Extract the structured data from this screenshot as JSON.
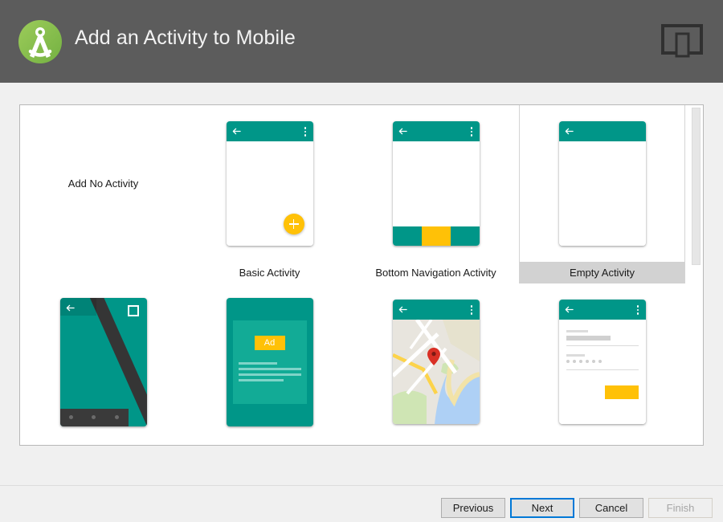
{
  "header": {
    "title": "Add an Activity to Mobile",
    "logo_icon": "android-studio-logo",
    "formfactor_icon": "mobile-device-icon"
  },
  "gallery": {
    "rows": [
      {
        "cells": [
          {
            "label": "",
            "note": "Add No Activity",
            "thumb": "none",
            "selected": false,
            "name": "activity-add-no-activity"
          },
          {
            "label": "Basic Activity",
            "note": "",
            "thumb": "basic",
            "selected": false,
            "name": "activity-basic"
          },
          {
            "label": "Bottom Navigation Activity",
            "note": "",
            "thumb": "bottomnav",
            "selected": false,
            "name": "activity-bottom-navigation"
          },
          {
            "label": "Empty Activity",
            "note": "",
            "thumb": "empty",
            "selected": true,
            "name": "activity-empty"
          }
        ]
      },
      {
        "cells": [
          {
            "label": "",
            "note": "",
            "thumb": "fullscreen",
            "selected": false,
            "name": "activity-fullscreen"
          },
          {
            "label": "",
            "note": "",
            "thumb": "admob",
            "selected": false,
            "name": "activity-google-admob-ads"
          },
          {
            "label": "",
            "note": "",
            "thumb": "maps",
            "selected": false,
            "name": "activity-google-maps"
          },
          {
            "label": "",
            "note": "",
            "thumb": "login",
            "selected": false,
            "name": "activity-login"
          }
        ]
      }
    ],
    "admob_badge": "Ad"
  },
  "scrollbar": {
    "orientation": "vertical",
    "thumb_top_pct": 0,
    "thumb_height_pct": 46
  },
  "footer": {
    "previous": "Previous",
    "next": "Next",
    "cancel": "Cancel",
    "finish": "Finish",
    "finish_enabled": false,
    "next_focused": true
  },
  "colors": {
    "header_bg": "#5c5c5c",
    "dialog_bg": "#f0f0f0",
    "panel_bg": "#ffffff",
    "teal": "#009688",
    "amber": "#FFC107",
    "selection_bg": "#d2d2d2",
    "focus_blue": "#0078d7",
    "logo_green": "#8bc34a"
  }
}
